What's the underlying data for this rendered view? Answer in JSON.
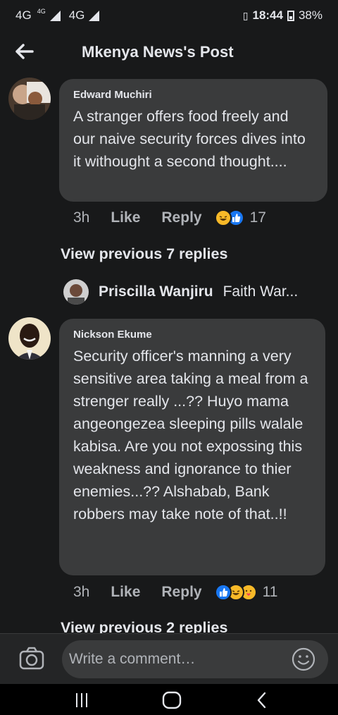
{
  "status_bar": {
    "network_1": "4G",
    "network_1_sup": "4G",
    "network_2": "4G",
    "time": "18:44",
    "battery": "38%"
  },
  "header": {
    "title": "Mkenya News's Post"
  },
  "comments": [
    {
      "author": "Edward Muchiri",
      "text": "A stranger offers food freely and our naive security forces dives into it withought a second thought....",
      "time": "3h",
      "like_label": "Like",
      "reply_label": "Reply",
      "reactions": [
        "haha",
        "like"
      ],
      "reaction_count": "17"
    },
    {
      "author": "Nickson Ekume",
      "text": "Security officer's manning a very sensitive area taking a meal from a strenger really ...?? Huyo mama angeongezea sleeping pills walale kabisa. Are you not expossing this weakness and ignorance to thier enemies...?? Alshabab, Bank robbers may take note of that..!!",
      "time": "3h",
      "like_label": "Like",
      "reply_label": "Reply",
      "reactions": [
        "like",
        "haha",
        "care"
      ],
      "reaction_count": "11"
    }
  ],
  "view_previous_1": "View previous 7 replies",
  "view_previous_2": "View previous 2 replies",
  "reply_preview": {
    "author": "Priscilla Wanjiru",
    "text": "Faith War..."
  },
  "composer": {
    "placeholder": "Write a comment…"
  },
  "colors": {
    "background": "#18191a",
    "bubble": "#3a3b3c",
    "like_blue": "#1877f2",
    "haha_yellow": "#f7b928"
  }
}
